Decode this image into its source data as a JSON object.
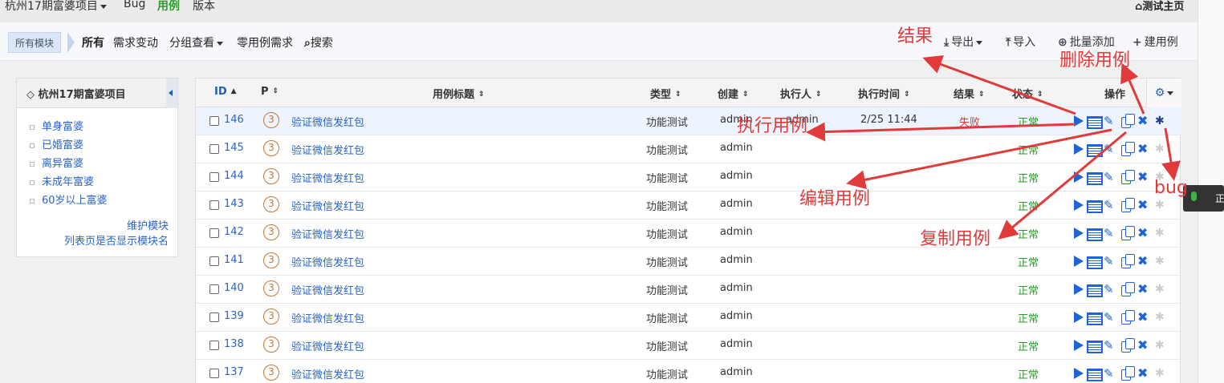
{
  "topnav": {
    "project": "杭州17期富婆项目",
    "bug": "Bug",
    "cases": "用例",
    "version": "版本",
    "home": "测试主页"
  },
  "toolbar": {
    "module_tag": "所有模块",
    "tabs": [
      "所有",
      "需求变动",
      "分组查看",
      "零用例需求"
    ],
    "search": "搜索",
    "export": "导出",
    "import": "导入",
    "batch_add": "批量添加",
    "create_case": "建用例"
  },
  "module_panel": {
    "title": "杭州17期富婆项目",
    "items": [
      "单身富婆",
      "已婚富婆",
      "离异富婆",
      "未成年富婆",
      "60岁以上富婆"
    ],
    "maintain": "维护模块",
    "show_module_name": "列表页是否显示模块名"
  },
  "table": {
    "headers": {
      "id": "ID",
      "pri": "P",
      "title": "用例标题",
      "type": "类型",
      "creator": "创建",
      "runner": "执行人",
      "run_time": "执行时间",
      "result": "结果",
      "status": "状态",
      "actions": "操作"
    },
    "rows": [
      {
        "id": "146",
        "pri": "3",
        "title": "验证微信发红包",
        "type": "功能测试",
        "creator": "admin",
        "runner": "admin",
        "run_time": "2/25 11:44",
        "result": "失败",
        "status": "正常"
      },
      {
        "id": "145",
        "pri": "3",
        "title": "验证微信发红包",
        "type": "功能测试",
        "creator": "admin",
        "runner": "",
        "run_time": "",
        "result": "",
        "status": "正常"
      },
      {
        "id": "144",
        "pri": "3",
        "title": "验证微信发红包",
        "type": "功能测试",
        "creator": "admin",
        "runner": "",
        "run_time": "",
        "result": "",
        "status": "正常"
      },
      {
        "id": "143",
        "pri": "3",
        "title": "验证微信发红包",
        "type": "功能测试",
        "creator": "admin",
        "runner": "",
        "run_time": "",
        "result": "",
        "status": "正常"
      },
      {
        "id": "142",
        "pri": "3",
        "title": "验证微信发红包",
        "type": "功能测试",
        "creator": "admin",
        "runner": "",
        "run_time": "",
        "result": "",
        "status": "正常"
      },
      {
        "id": "141",
        "pri": "3",
        "title": "验证微信发红包",
        "type": "功能测试",
        "creator": "admin",
        "runner": "",
        "run_time": "",
        "result": "",
        "status": "正常"
      },
      {
        "id": "140",
        "pri": "3",
        "title": "验证微信发红包",
        "type": "功能测试",
        "creator": "admin",
        "runner": "",
        "run_time": "",
        "result": "",
        "status": "正常"
      },
      {
        "id": "139",
        "pri": "3",
        "title": "验证微信发红包",
        "type": "功能测试",
        "creator": "admin",
        "runner": "",
        "run_time": "",
        "result": "",
        "status": "正常"
      },
      {
        "id": "138",
        "pri": "3",
        "title": "验证微信发红包",
        "type": "功能测试",
        "creator": "admin",
        "runner": "",
        "run_time": "",
        "result": "",
        "status": "正常"
      },
      {
        "id": "137",
        "pri": "3",
        "title": "验证微信发红包",
        "type": "功能测试",
        "creator": "admin",
        "runner": "",
        "run_time": "",
        "result": "",
        "status": "正常"
      }
    ]
  },
  "annotations": {
    "result": "结果",
    "delete_case": "删除用例",
    "run_case": "执行用例",
    "edit_case": "编辑用例",
    "copy_case": "复制用例",
    "bug": "bug"
  },
  "voice_widget": {
    "text": "正"
  },
  "colors": {
    "annotation": "#e23a3a",
    "link": "#2b64c8",
    "ok": "#2a9a2a",
    "fail": "#d43f3a"
  }
}
